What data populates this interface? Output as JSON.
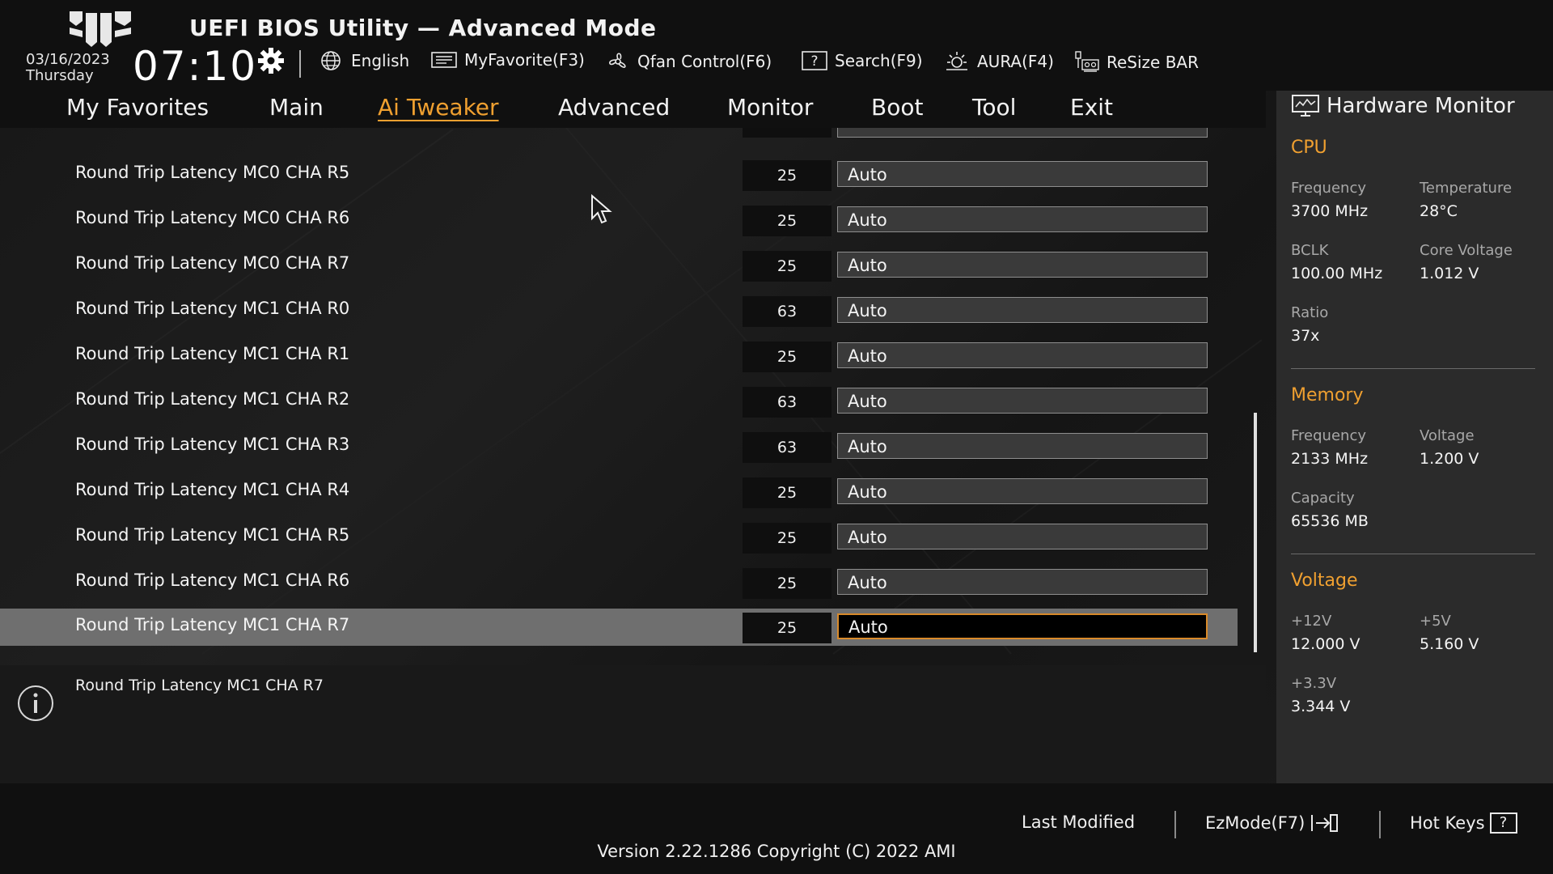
{
  "header": {
    "title": "UEFI BIOS Utility — Advanced Mode",
    "date": "03/16/2023",
    "day": "Thursday",
    "time": "07:10",
    "toolbar": [
      {
        "label": "English",
        "icon": "globe-icon"
      },
      {
        "label": "MyFavorite(F3)",
        "icon": "favorite-icon"
      },
      {
        "label": "Qfan Control(F6)",
        "icon": "fan-icon"
      },
      {
        "label": "Search(F9)",
        "icon": "search-icon"
      },
      {
        "label": "AURA(F4)",
        "icon": "aura-icon"
      },
      {
        "label": "ReSize BAR",
        "icon": "resize-bar-icon"
      }
    ]
  },
  "nav": {
    "tabs": [
      {
        "label": "My Favorites",
        "active": false
      },
      {
        "label": "Main",
        "active": false
      },
      {
        "label": "Ai Tweaker",
        "active": true
      },
      {
        "label": "Advanced",
        "active": false
      },
      {
        "label": "Monitor",
        "active": false
      },
      {
        "label": "Boot",
        "active": false
      },
      {
        "label": "Tool",
        "active": false
      },
      {
        "label": "Exit",
        "active": false
      }
    ]
  },
  "settings": {
    "rows": [
      {
        "label": "Round Trip Latency MC0 CHA R5",
        "value": "25",
        "setting": "Auto"
      },
      {
        "label": "Round Trip Latency MC0 CHA R6",
        "value": "25",
        "setting": "Auto"
      },
      {
        "label": "Round Trip Latency MC0 CHA R7",
        "value": "25",
        "setting": "Auto"
      },
      {
        "label": "Round Trip Latency MC1 CHA R0",
        "value": "63",
        "setting": "Auto"
      },
      {
        "label": "Round Trip Latency MC1 CHA R1",
        "value": "25",
        "setting": "Auto"
      },
      {
        "label": "Round Trip Latency MC1 CHA R2",
        "value": "63",
        "setting": "Auto"
      },
      {
        "label": "Round Trip Latency MC1 CHA R3",
        "value": "63",
        "setting": "Auto"
      },
      {
        "label": "Round Trip Latency MC1 CHA R4",
        "value": "25",
        "setting": "Auto"
      },
      {
        "label": "Round Trip Latency MC1 CHA R5",
        "value": "25",
        "setting": "Auto"
      },
      {
        "label": "Round Trip Latency MC1 CHA R6",
        "value": "25",
        "setting": "Auto"
      },
      {
        "label": "Round Trip Latency MC1 CHA R7",
        "value": "25",
        "setting": "Auto",
        "selected": true
      }
    ]
  },
  "info": {
    "text": "Round Trip Latency MC1 CHA R7"
  },
  "hardware_monitor": {
    "title": "Hardware Monitor",
    "cpu": {
      "heading": "CPU",
      "frequency_label": "Frequency",
      "frequency": "3700 MHz",
      "temperature_label": "Temperature",
      "temperature": "28°C",
      "bclk_label": "BCLK",
      "bclk": "100.00 MHz",
      "core_voltage_label": "Core Voltage",
      "core_voltage": "1.012 V",
      "ratio_label": "Ratio",
      "ratio": "37x"
    },
    "memory": {
      "heading": "Memory",
      "frequency_label": "Frequency",
      "frequency": "2133 MHz",
      "voltage_label": "Voltage",
      "voltage": "1.200 V",
      "capacity_label": "Capacity",
      "capacity": "65536 MB"
    },
    "voltage": {
      "heading": "Voltage",
      "v12_label": "+12V",
      "v12": "12.000 V",
      "v5_label": "+5V",
      "v5": "5.160 V",
      "v33_label": "+3.3V",
      "v33": "3.344 V"
    }
  },
  "footer": {
    "last_modified": "Last Modified",
    "ezmode": "EzMode(F7)",
    "hot_keys": "Hot Keys",
    "hot_keys_glyph": "?",
    "version": "Version 2.22.1286 Copyright (C) 2022 AMI"
  },
  "colors": {
    "accent": "#f0a030",
    "selected_border": "#d98a2a",
    "selected_row": "#6f6f6f"
  }
}
